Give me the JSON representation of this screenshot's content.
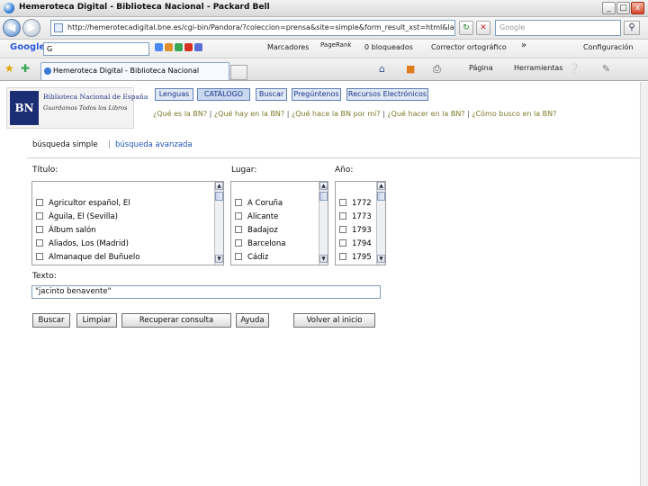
{
  "window": {
    "title": "Hemeroteca Digital - Biblioteca Nacional - Packard Bell",
    "minimize": "_",
    "maximize": "□",
    "close": "x"
  },
  "browser": {
    "back_icon": "back-arrow-icon",
    "forward_icon": "forward-arrow-icon",
    "address": "http://hemerotecadigital.bne.es/cgi-bin/Pandora/?coleccion=prensa&site=simple&form_result_xst=html&lang=",
    "search_placeholder": "Google",
    "tab_title": "Hemeroteca Digital - Biblioteca Nacional",
    "more_symbol": "»"
  },
  "google_toolbar": {
    "logo": "Google",
    "box_value": "G",
    "items": [
      "Marcadores",
      "PageRank",
      "0 bloqueados",
      "Corrector ortográfico",
      "Configuración"
    ]
  },
  "command_bar": {
    "page_label": "Página",
    "tools_label": "Herramientas"
  },
  "site": {
    "logo_title": "Biblioteca Nacional de España",
    "logo_subtitle": "Guardamos Todos los Libros",
    "logo_mark": "BN",
    "menu": [
      "Lenguas",
      "CATÁLOGO",
      "Buscar",
      "Pregúntenos",
      "Recursos Electrónicos"
    ],
    "quick_links": [
      "¿Qué es la BN?",
      "¿Qué hay en la BN?",
      "¿Qué hace la BN por mí?",
      "¿Qué hacer en la BN?",
      "¿Cómo busco en la BN?"
    ],
    "separator": "|"
  },
  "search": {
    "mode_simple": "búsqueda simple",
    "mode_separator": "|",
    "mode_advanced": "búsqueda avanzada",
    "title_label": "Título:",
    "place_label": "Lugar:",
    "year_label": "Año:",
    "titles": [
      "Agricultor español, El",
      "Águila, El (Sevilla)",
      "Álbum salón",
      "Aliados, Los (Madrid)",
      "Almanaque del Buñuelo"
    ],
    "places": [
      "A Coruña",
      "Alicante",
      "Badajoz",
      "Barcelona",
      "Cádiz"
    ],
    "years": [
      "1772",
      "1773",
      "1793",
      "1794",
      "1795"
    ],
    "text_label": "Texto:",
    "text_value": "\"jacinto benavente\"",
    "buttons": [
      "Buscar",
      "Limpiar",
      "Recuperar consulta",
      "Ayuda",
      "Volver al inicio"
    ]
  }
}
